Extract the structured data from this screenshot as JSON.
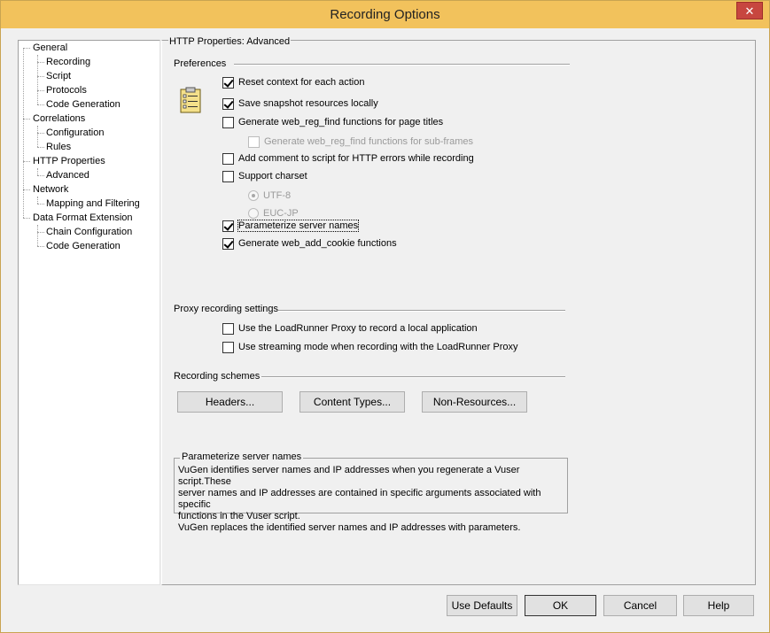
{
  "window": {
    "title": "Recording Options",
    "close_glyph": "✕"
  },
  "tree": {
    "items": [
      {
        "label": "General",
        "level": 0
      },
      {
        "label": "Recording",
        "level": 1
      },
      {
        "label": "Script",
        "level": 1
      },
      {
        "label": "Protocols",
        "level": 1
      },
      {
        "label": "Code Generation",
        "level": 1
      },
      {
        "label": "Correlations",
        "level": 0
      },
      {
        "label": "Configuration",
        "level": 1
      },
      {
        "label": "Rules",
        "level": 1
      },
      {
        "label": "HTTP Properties",
        "level": 0
      },
      {
        "label": "Advanced",
        "level": 1
      },
      {
        "label": "Network",
        "level": 0
      },
      {
        "label": "Mapping and Filtering",
        "level": 1
      },
      {
        "label": "Data Format Extension",
        "level": 0
      },
      {
        "label": "Chain Configuration",
        "level": 1
      },
      {
        "label": "Code Generation",
        "level": 1
      }
    ]
  },
  "panel": {
    "caption": "HTTP Properties: Advanced",
    "preferences": {
      "label": "Preferences",
      "options": [
        {
          "label": "Reset context for each action",
          "checked": true
        },
        {
          "label": "Save snapshot resources locally",
          "checked": true
        },
        {
          "label": "Generate web_reg_find functions for page titles",
          "checked": false
        },
        {
          "label": "Generate web_reg_find functions for sub-frames",
          "checked": false,
          "disabled": true
        },
        {
          "label": "Add comment to script for HTTP errors while recording",
          "checked": false
        },
        {
          "label": "Support charset",
          "checked": false
        },
        {
          "label": "UTF-8",
          "radio": true,
          "selected": true,
          "disabled": true
        },
        {
          "label": "EUC-JP",
          "radio": true,
          "selected": false,
          "disabled": true
        },
        {
          "label": "Parameterize server names",
          "checked": true
        },
        {
          "label": "Generate web_add_cookie functions",
          "checked": true
        }
      ]
    },
    "proxy": {
      "label": "Proxy recording settings",
      "options": [
        {
          "label": "Use the LoadRunner Proxy to record a local application",
          "checked": false
        },
        {
          "label": "Use streaming mode when recording with the LoadRunner Proxy",
          "checked": false
        }
      ]
    },
    "schemes": {
      "label": "Recording schemes",
      "buttons": [
        "Headers...",
        "Content Types...",
        "Non-Resources..."
      ]
    },
    "description": {
      "title": "Parameterize server names",
      "lines": [
        "VuGen identifies server names and IP addresses when you regenerate a Vuser script.These",
        "server names and IP addresses are contained in specific arguments associated with specific",
        "functions in the Vuser script.",
        "VuGen replaces the identified server names and IP addresses with  parameters."
      ]
    }
  },
  "footer": {
    "use_defaults": "Use Defaults",
    "ok": "OK",
    "cancel": "Cancel",
    "help": "Help"
  }
}
